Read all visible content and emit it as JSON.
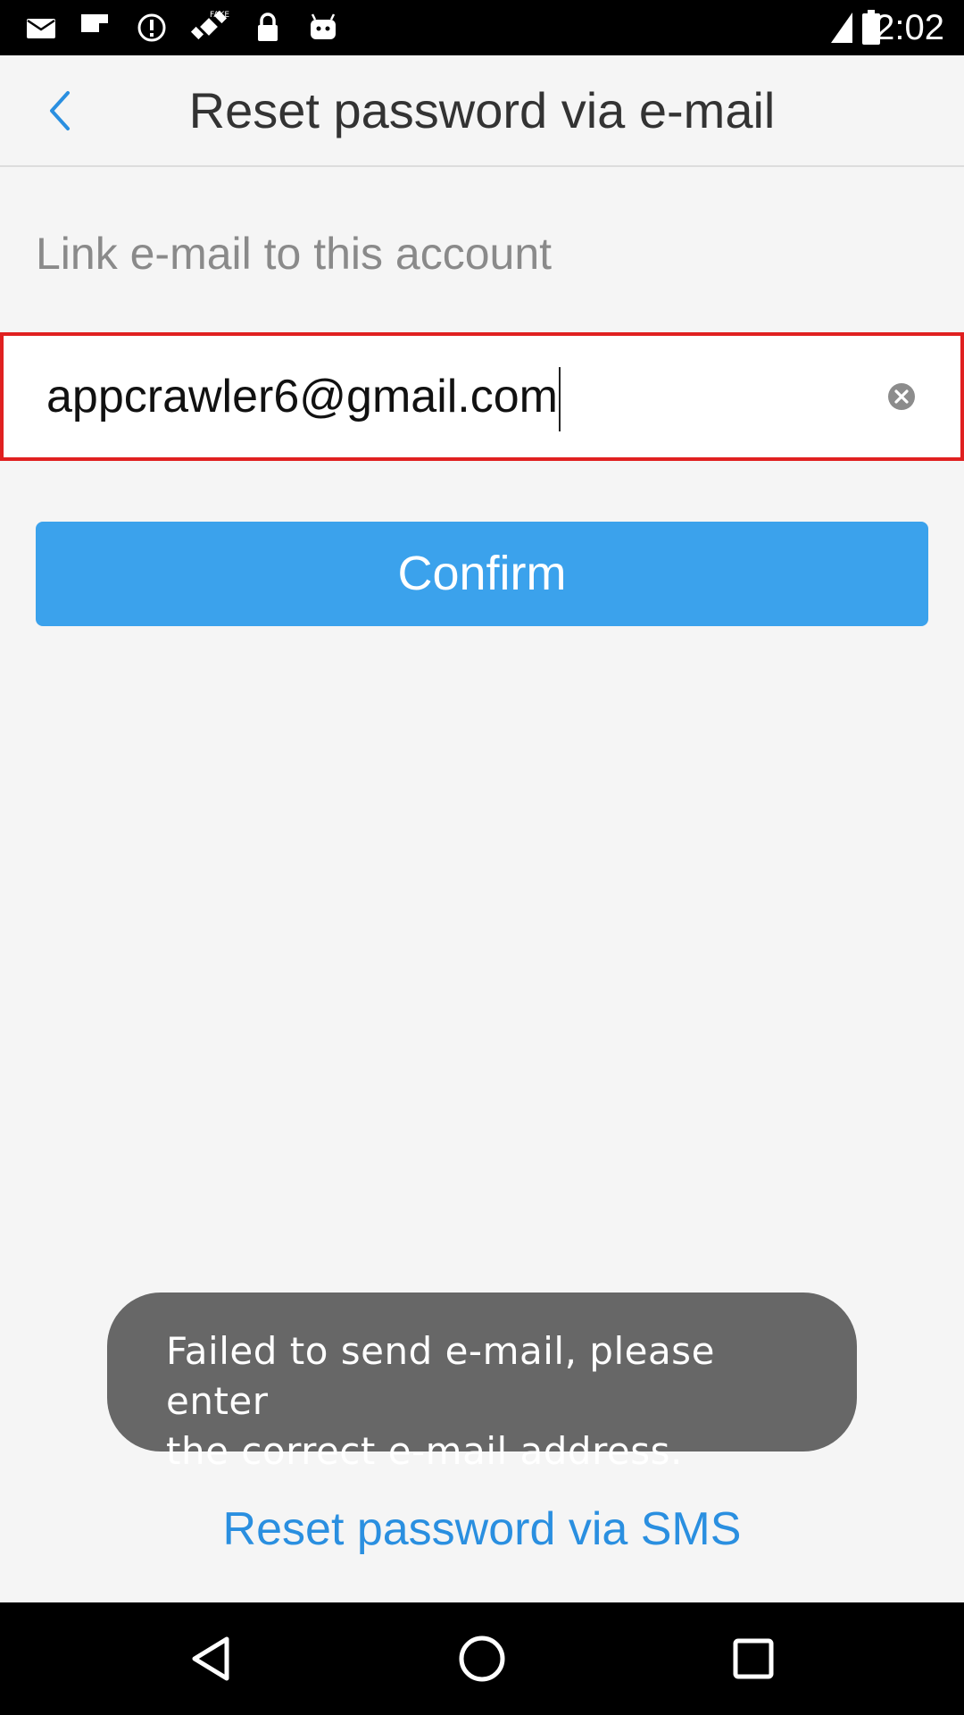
{
  "status_bar": {
    "time": "2:02",
    "icons": [
      "mail-icon",
      "flipboard-icon",
      "alert-icon",
      "fake-gps-icon",
      "lock-icon",
      "android-icon",
      "signal-icon",
      "battery-icon"
    ]
  },
  "header": {
    "title": "Reset password via e-mail",
    "back_icon": "chevron-left-icon"
  },
  "form": {
    "section_label": "Link e-mail to this account",
    "email_value": "appcrawler6@gmail.com",
    "clear_icon": "clear-circle-icon",
    "confirm_label": "Confirm"
  },
  "toast": {
    "line1": "Failed to send e-mail, please enter",
    "line2": "the correct e-mail address."
  },
  "links": {
    "sms": "Reset password via SMS"
  },
  "nav_bar": {
    "icons": [
      "back-triangle-icon",
      "home-circle-icon",
      "recents-square-icon"
    ]
  },
  "colors": {
    "accent": "#3ba2ec",
    "link": "#2a8fe0",
    "field_highlight": "#e02020",
    "toast_bg": "#676767"
  }
}
